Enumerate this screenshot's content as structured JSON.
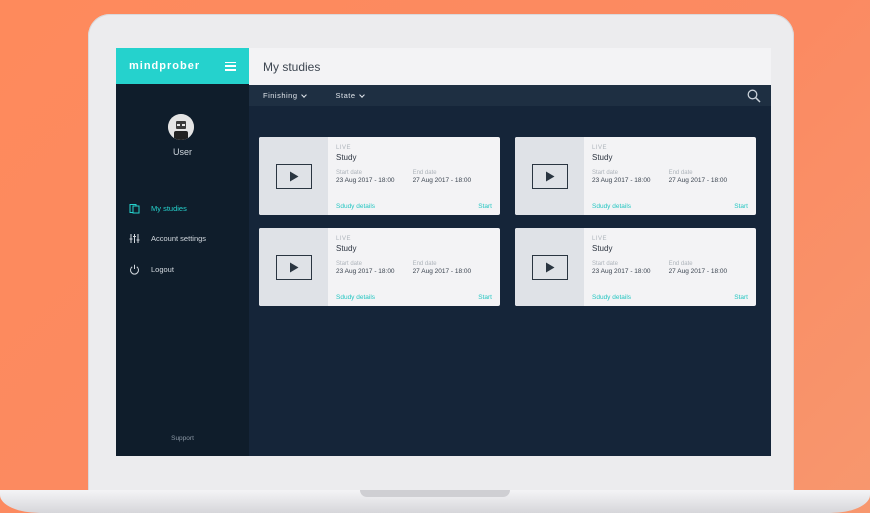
{
  "app": {
    "brand": "mindprober",
    "page_title": "My studies",
    "accent_color": "#25d2cd"
  },
  "user": {
    "name": "User",
    "avatar_icon": "user-avatar"
  },
  "sidebar": {
    "items": [
      {
        "label": "My studies",
        "icon": "document-icon",
        "active": true
      },
      {
        "label": "Account settings",
        "icon": "sliders-icon",
        "active": false
      },
      {
        "label": "Logout",
        "icon": "power-icon",
        "active": false
      }
    ],
    "support": "Support"
  },
  "filters": {
    "items": [
      {
        "label": "Finishing"
      },
      {
        "label": "State"
      }
    ],
    "search_icon": "search-icon"
  },
  "cards": [
    {
      "status": "LIVE",
      "name": "Study",
      "start_label": "Start date",
      "start_value": "23 Aug 2017 - 18:00",
      "end_label": "End date",
      "end_value": "27 Aug 2017 - 18:00",
      "details_label": "Sdudy details",
      "start_action": "Start"
    },
    {
      "status": "LIVE",
      "name": "Study",
      "start_label": "Start date",
      "start_value": "23 Aug 2017 - 18:00",
      "end_label": "End date",
      "end_value": "27 Aug 2017 - 18:00",
      "details_label": "Sdudy details",
      "start_action": "Start"
    },
    {
      "status": "LIVE",
      "name": "Study",
      "start_label": "Start date",
      "start_value": "23 Aug 2017 - 18:00",
      "end_label": "End date",
      "end_value": "27 Aug 2017 - 18:00",
      "details_label": "Sdudy details",
      "start_action": "Start"
    },
    {
      "status": "LIVE",
      "name": "Study",
      "start_label": "Start date",
      "start_value": "23 Aug 2017 - 18:00",
      "end_label": "End date",
      "end_value": "27 Aug 2017 - 18:00",
      "details_label": "Sdudy details",
      "start_action": "Start"
    }
  ]
}
